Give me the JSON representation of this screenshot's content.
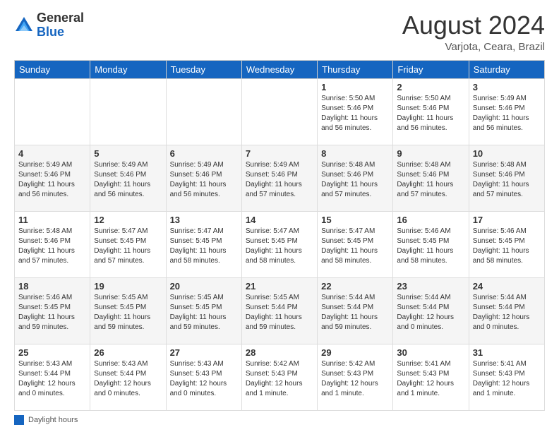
{
  "header": {
    "logo": {
      "general": "General",
      "blue": "Blue"
    },
    "title": "August 2024",
    "location": "Varjota, Ceara, Brazil"
  },
  "days_of_week": [
    "Sunday",
    "Monday",
    "Tuesday",
    "Wednesday",
    "Thursday",
    "Friday",
    "Saturday"
  ],
  "weeks": [
    [
      {
        "day": "",
        "info": ""
      },
      {
        "day": "",
        "info": ""
      },
      {
        "day": "",
        "info": ""
      },
      {
        "day": "",
        "info": ""
      },
      {
        "day": "1",
        "info": "Sunrise: 5:50 AM\nSunset: 5:46 PM\nDaylight: 11 hours and 56 minutes."
      },
      {
        "day": "2",
        "info": "Sunrise: 5:50 AM\nSunset: 5:46 PM\nDaylight: 11 hours and 56 minutes."
      },
      {
        "day": "3",
        "info": "Sunrise: 5:49 AM\nSunset: 5:46 PM\nDaylight: 11 hours and 56 minutes."
      }
    ],
    [
      {
        "day": "4",
        "info": "Sunrise: 5:49 AM\nSunset: 5:46 PM\nDaylight: 11 hours and 56 minutes."
      },
      {
        "day": "5",
        "info": "Sunrise: 5:49 AM\nSunset: 5:46 PM\nDaylight: 11 hours and 56 minutes."
      },
      {
        "day": "6",
        "info": "Sunrise: 5:49 AM\nSunset: 5:46 PM\nDaylight: 11 hours and 56 minutes."
      },
      {
        "day": "7",
        "info": "Sunrise: 5:49 AM\nSunset: 5:46 PM\nDaylight: 11 hours and 57 minutes."
      },
      {
        "day": "8",
        "info": "Sunrise: 5:48 AM\nSunset: 5:46 PM\nDaylight: 11 hours and 57 minutes."
      },
      {
        "day": "9",
        "info": "Sunrise: 5:48 AM\nSunset: 5:46 PM\nDaylight: 11 hours and 57 minutes."
      },
      {
        "day": "10",
        "info": "Sunrise: 5:48 AM\nSunset: 5:46 PM\nDaylight: 11 hours and 57 minutes."
      }
    ],
    [
      {
        "day": "11",
        "info": "Sunrise: 5:48 AM\nSunset: 5:46 PM\nDaylight: 11 hours and 57 minutes."
      },
      {
        "day": "12",
        "info": "Sunrise: 5:47 AM\nSunset: 5:45 PM\nDaylight: 11 hours and 57 minutes."
      },
      {
        "day": "13",
        "info": "Sunrise: 5:47 AM\nSunset: 5:45 PM\nDaylight: 11 hours and 58 minutes."
      },
      {
        "day": "14",
        "info": "Sunrise: 5:47 AM\nSunset: 5:45 PM\nDaylight: 11 hours and 58 minutes."
      },
      {
        "day": "15",
        "info": "Sunrise: 5:47 AM\nSunset: 5:45 PM\nDaylight: 11 hours and 58 minutes."
      },
      {
        "day": "16",
        "info": "Sunrise: 5:46 AM\nSunset: 5:45 PM\nDaylight: 11 hours and 58 minutes."
      },
      {
        "day": "17",
        "info": "Sunrise: 5:46 AM\nSunset: 5:45 PM\nDaylight: 11 hours and 58 minutes."
      }
    ],
    [
      {
        "day": "18",
        "info": "Sunrise: 5:46 AM\nSunset: 5:45 PM\nDaylight: 11 hours and 59 minutes."
      },
      {
        "day": "19",
        "info": "Sunrise: 5:45 AM\nSunset: 5:45 PM\nDaylight: 11 hours and 59 minutes."
      },
      {
        "day": "20",
        "info": "Sunrise: 5:45 AM\nSunset: 5:45 PM\nDaylight: 11 hours and 59 minutes."
      },
      {
        "day": "21",
        "info": "Sunrise: 5:45 AM\nSunset: 5:44 PM\nDaylight: 11 hours and 59 minutes."
      },
      {
        "day": "22",
        "info": "Sunrise: 5:44 AM\nSunset: 5:44 PM\nDaylight: 11 hours and 59 minutes."
      },
      {
        "day": "23",
        "info": "Sunrise: 5:44 AM\nSunset: 5:44 PM\nDaylight: 12 hours and 0 minutes."
      },
      {
        "day": "24",
        "info": "Sunrise: 5:44 AM\nSunset: 5:44 PM\nDaylight: 12 hours and 0 minutes."
      }
    ],
    [
      {
        "day": "25",
        "info": "Sunrise: 5:43 AM\nSunset: 5:44 PM\nDaylight: 12 hours and 0 minutes."
      },
      {
        "day": "26",
        "info": "Sunrise: 5:43 AM\nSunset: 5:44 PM\nDaylight: 12 hours and 0 minutes."
      },
      {
        "day": "27",
        "info": "Sunrise: 5:43 AM\nSunset: 5:43 PM\nDaylight: 12 hours and 0 minutes."
      },
      {
        "day": "28",
        "info": "Sunrise: 5:42 AM\nSunset: 5:43 PM\nDaylight: 12 hours and 1 minute."
      },
      {
        "day": "29",
        "info": "Sunrise: 5:42 AM\nSunset: 5:43 PM\nDaylight: 12 hours and 1 minute."
      },
      {
        "day": "30",
        "info": "Sunrise: 5:41 AM\nSunset: 5:43 PM\nDaylight: 12 hours and 1 minute."
      },
      {
        "day": "31",
        "info": "Sunrise: 5:41 AM\nSunset: 5:43 PM\nDaylight: 12 hours and 1 minute."
      }
    ]
  ],
  "footer": {
    "daylight_label": "Daylight hours"
  }
}
